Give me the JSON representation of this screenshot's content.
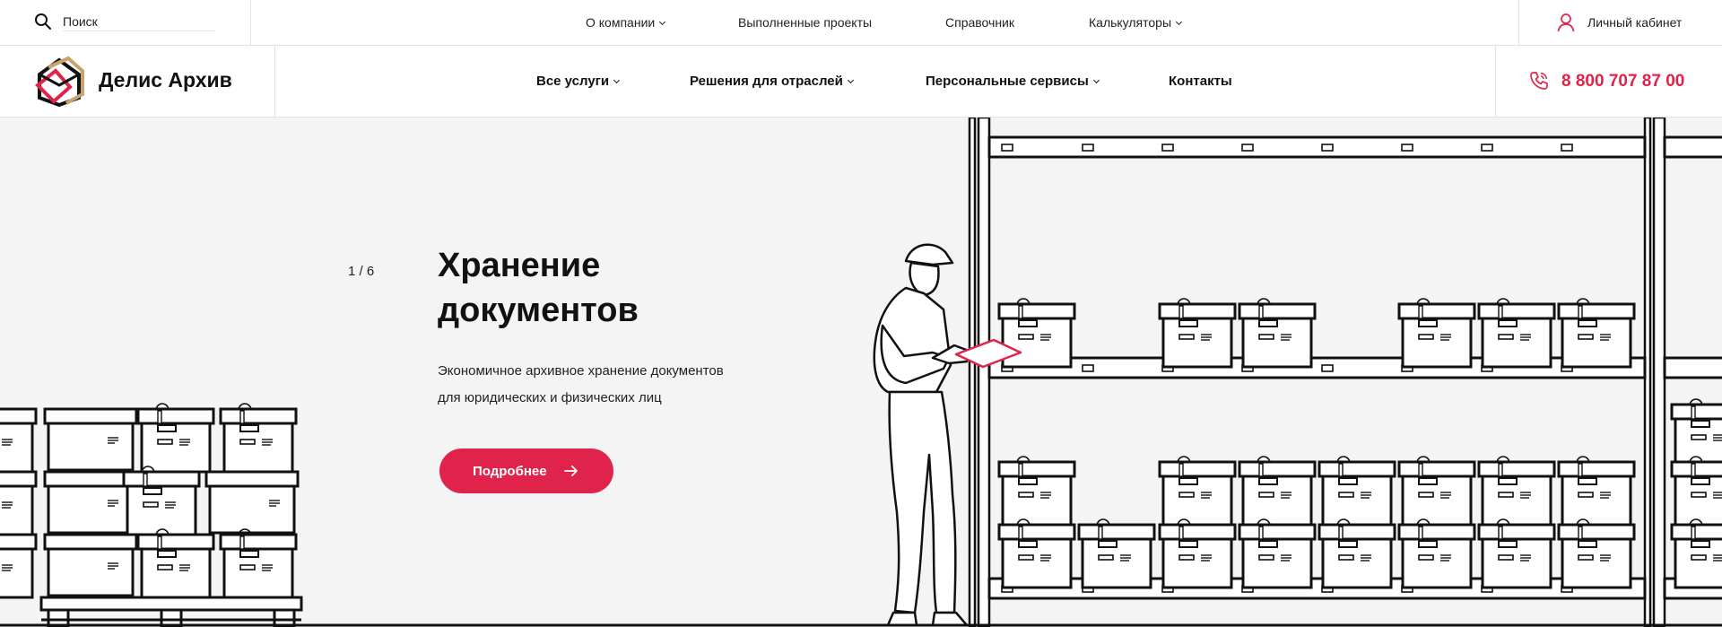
{
  "header": {
    "search": {
      "placeholder": "Поиск"
    },
    "top_nav": [
      {
        "label": "О компании",
        "has_dropdown": true
      },
      {
        "label": "Выполненные проекты",
        "has_dropdown": false
      },
      {
        "label": "Справочник",
        "has_dropdown": false
      },
      {
        "label": "Калькуляторы",
        "has_dropdown": true
      }
    ],
    "account_label": "Личный кабинет",
    "brand": "Делис Архив",
    "main_nav": [
      {
        "label": "Все услуги",
        "has_dropdown": true
      },
      {
        "label": "Решения для отраслей",
        "has_dropdown": true
      },
      {
        "label": "Персональные сервисы",
        "has_dropdown": true
      },
      {
        "label": "Контакты",
        "has_dropdown": false
      }
    ],
    "phone": "8 800 707 87 00"
  },
  "hero": {
    "counter": "1 / 6",
    "title_line1": "Хранение",
    "title_line2": "документов",
    "description_line1": "Экономичное архивное хранение документов",
    "description_line2": "для юридических и физических лиц",
    "cta_label": "Подробнее"
  },
  "colors": {
    "accent": "#e0234a",
    "hero_bg": "#f4f4f4",
    "logo_gold": "#c9a46a"
  },
  "icons": [
    "search-icon",
    "user-icon",
    "logo-icon",
    "phone-icon",
    "arrow-right-icon",
    "chevron-down-icon"
  ]
}
